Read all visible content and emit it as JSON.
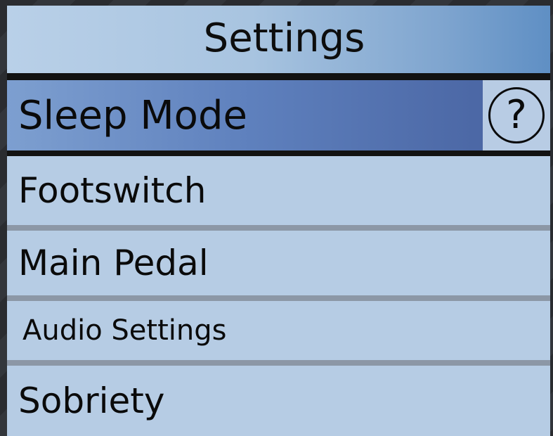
{
  "header": {
    "title": "Settings"
  },
  "menu": {
    "items": [
      {
        "label": "Sleep Mode",
        "selected": true
      },
      {
        "label": "Footswitch",
        "selected": false
      },
      {
        "label": "Main Pedal",
        "selected": false
      },
      {
        "label": "Audio Settings",
        "selected": false
      },
      {
        "label": "Sobriety",
        "selected": false
      }
    ],
    "help_icon": "question-circle-icon",
    "help_glyph": "?"
  },
  "colors": {
    "panel_bg": "#b5cbe3",
    "selected_bg": "#46609e",
    "divider": "#121212"
  }
}
